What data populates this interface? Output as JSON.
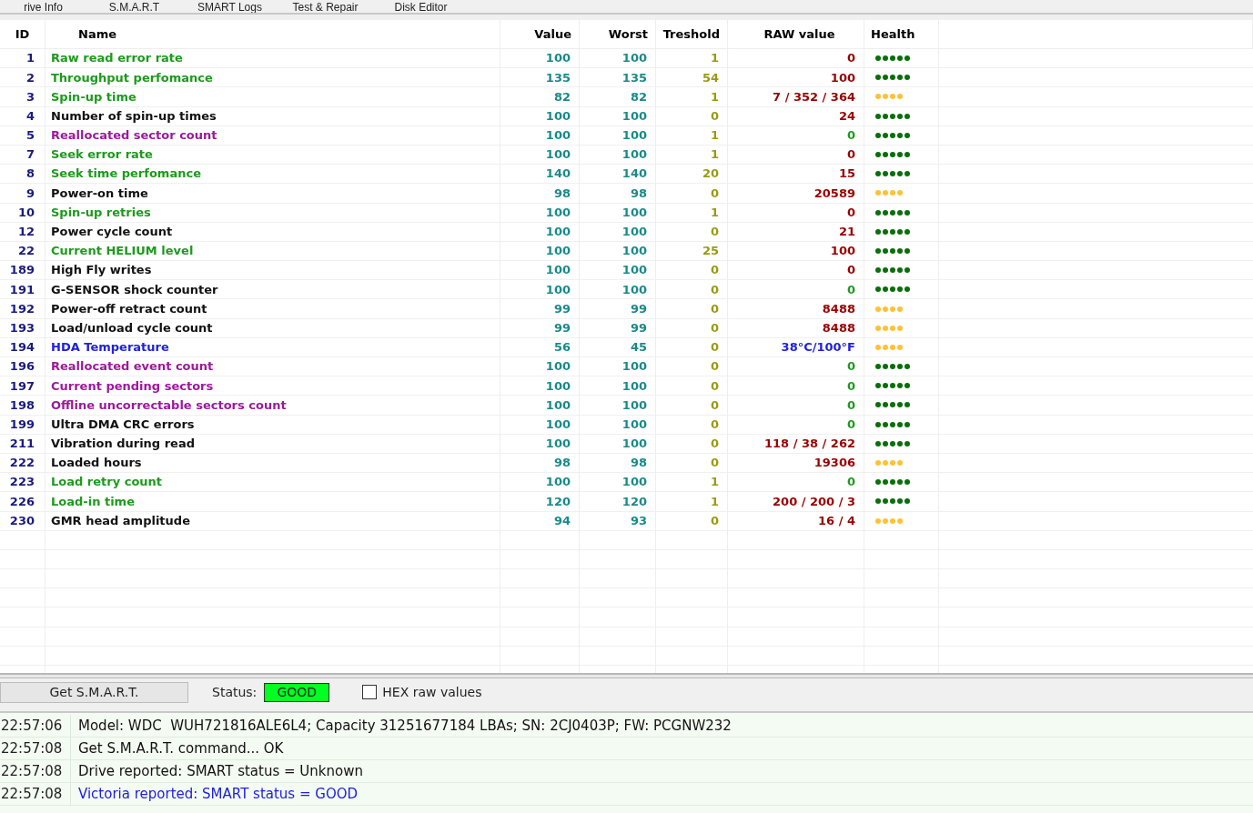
{
  "tabs": [
    {
      "label": "rive Info"
    },
    {
      "label": "S.M.A.R.T"
    },
    {
      "label": "SMART Logs"
    },
    {
      "label": "Test & Repair"
    },
    {
      "label": "Disk Editor"
    }
  ],
  "table": {
    "columns": [
      "ID",
      "Name",
      "Value",
      "Worst",
      "Treshold",
      "RAW value",
      "Health"
    ],
    "rows": [
      {
        "id": "1",
        "name": "Raw read error rate",
        "color": "#1e9a1e",
        "value": "100",
        "worst": "100",
        "threshold": "1",
        "raw": {
          "text": "0",
          "color": "#990000"
        },
        "stars": 5
      },
      {
        "id": "2",
        "name": "Throughput perfomance",
        "color": "#1e9a1e",
        "value": "135",
        "worst": "135",
        "threshold": "54",
        "raw": {
          "text": "100",
          "color": "#990000"
        },
        "stars": 5
      },
      {
        "id": "3",
        "name": "Spin-up time",
        "color": "#1e9a1e",
        "value": "82",
        "worst": "82",
        "threshold": "1",
        "raw": {
          "text": "7 / 352 / 364",
          "color": "#990000"
        },
        "stars": 4
      },
      {
        "id": "4",
        "name": "Number of spin-up times",
        "color": "#111111",
        "value": "100",
        "worst": "100",
        "threshold": "0",
        "raw": {
          "text": "24",
          "color": "#990000"
        },
        "stars": 5
      },
      {
        "id": "5",
        "name": "Reallocated sector count",
        "color": "#9b1a9b",
        "value": "100",
        "worst": "100",
        "threshold": "1",
        "raw": {
          "text": "0",
          "color": "#1e9a1e"
        },
        "stars": 5
      },
      {
        "id": "7",
        "name": "Seek error rate",
        "color": "#1e9a1e",
        "value": "100",
        "worst": "100",
        "threshold": "1",
        "raw": {
          "text": "0",
          "color": "#990000"
        },
        "stars": 5
      },
      {
        "id": "8",
        "name": "Seek time perfomance",
        "color": "#1e9a1e",
        "value": "140",
        "worst": "140",
        "threshold": "20",
        "raw": {
          "text": "15",
          "color": "#990000"
        },
        "stars": 5
      },
      {
        "id": "9",
        "name": "Power-on time",
        "color": "#111111",
        "value": "98",
        "worst": "98",
        "threshold": "0",
        "raw": {
          "text": "20589",
          "color": "#990000"
        },
        "stars": 4
      },
      {
        "id": "10",
        "name": "Spin-up retries",
        "color": "#1e9a1e",
        "value": "100",
        "worst": "100",
        "threshold": "1",
        "raw": {
          "text": "0",
          "color": "#990000"
        },
        "stars": 5
      },
      {
        "id": "12",
        "name": "Power cycle count",
        "color": "#111111",
        "value": "100",
        "worst": "100",
        "threshold": "0",
        "raw": {
          "text": "21",
          "color": "#990000"
        },
        "stars": 5
      },
      {
        "id": "22",
        "name": "Current HELIUM level",
        "color": "#1e9a1e",
        "value": "100",
        "worst": "100",
        "threshold": "25",
        "raw": {
          "text": "100",
          "color": "#990000"
        },
        "stars": 5
      },
      {
        "id": "189",
        "name": "High Fly writes",
        "color": "#111111",
        "value": "100",
        "worst": "100",
        "threshold": "0",
        "raw": {
          "text": "0",
          "color": "#990000"
        },
        "stars": 5
      },
      {
        "id": "191",
        "name": "G-SENSOR shock counter",
        "color": "#111111",
        "value": "100",
        "worst": "100",
        "threshold": "0",
        "raw": {
          "text": "0",
          "color": "#1e9a1e"
        },
        "stars": 5
      },
      {
        "id": "192",
        "name": "Power-off retract count",
        "color": "#111111",
        "value": "99",
        "worst": "99",
        "threshold": "0",
        "raw": {
          "text": "8488",
          "color": "#990000"
        },
        "stars": 4
      },
      {
        "id": "193",
        "name": "Load/unload cycle count",
        "color": "#111111",
        "value": "99",
        "worst": "99",
        "threshold": "0",
        "raw": {
          "text": "8488",
          "color": "#990000"
        },
        "stars": 4
      },
      {
        "id": "194",
        "name": "HDA Temperature",
        "color": "#2020e0",
        "value": "56",
        "worst": "45",
        "threshold": "0",
        "raw": {
          "text": "38°C/100°F",
          "color": "#2020e0"
        },
        "stars": 4
      },
      {
        "id": "196",
        "name": "Reallocated event count",
        "color": "#9b1a9b",
        "value": "100",
        "worst": "100",
        "threshold": "0",
        "raw": {
          "text": "0",
          "color": "#1e9a1e"
        },
        "stars": 5
      },
      {
        "id": "197",
        "name": "Current pending sectors",
        "color": "#9b1a9b",
        "value": "100",
        "worst": "100",
        "threshold": "0",
        "raw": {
          "text": "0",
          "color": "#1e9a1e"
        },
        "stars": 5
      },
      {
        "id": "198",
        "name": "Offline uncorrectable sectors count",
        "color": "#9b1a9b",
        "value": "100",
        "worst": "100",
        "threshold": "0",
        "raw": {
          "text": "0",
          "color": "#1e9a1e"
        },
        "stars": 5
      },
      {
        "id": "199",
        "name": "Ultra DMA CRC errors",
        "color": "#111111",
        "value": "100",
        "worst": "100",
        "threshold": "0",
        "raw": {
          "text": "0",
          "color": "#1e9a1e"
        },
        "stars": 5
      },
      {
        "id": "211",
        "name": "Vibration during read",
        "color": "#111111",
        "value": "100",
        "worst": "100",
        "threshold": "0",
        "raw": {
          "text": "118 / 38 / 262",
          "color": "#990000"
        },
        "stars": 5
      },
      {
        "id": "222",
        "name": "Loaded hours",
        "color": "#111111",
        "value": "98",
        "worst": "98",
        "threshold": "0",
        "raw": {
          "text": "19306",
          "color": "#990000"
        },
        "stars": 4
      },
      {
        "id": "223",
        "name": "Load retry count",
        "color": "#1e9a1e",
        "value": "100",
        "worst": "100",
        "threshold": "1",
        "raw": {
          "text": "0",
          "color": "#1e9a1e"
        },
        "stars": 5
      },
      {
        "id": "226",
        "name": "Load-in time",
        "color": "#1e9a1e",
        "value": "120",
        "worst": "120",
        "threshold": "1",
        "raw": {
          "text": "200 / 200 / 3",
          "color": "#990000"
        },
        "stars": 5
      },
      {
        "id": "230",
        "name": "GMR head amplitude",
        "color": "#111111",
        "value": "94",
        "worst": "93",
        "threshold": "0",
        "raw": {
          "text": "16 / 4",
          "color": "#990000"
        },
        "stars": 4
      }
    ]
  },
  "controls": {
    "button": "Get S.M.A.R.T.",
    "status_label": "Status:",
    "status": "GOOD",
    "hex": {
      "label": "HEX raw values",
      "checked": false
    }
  },
  "log": [
    {
      "time": "22:57:06",
      "message": "Model: WDC  WUH721816ALE6L4; Capacity 31251677184 LBAs; SN: 2CJ0403P; FW: PCGNW232",
      "color": "#111111"
    },
    {
      "time": "22:57:08",
      "message": "Get S.M.A.R.T. command... OK",
      "color": "#111111"
    },
    {
      "time": "22:57:08",
      "message": "Drive reported: SMART status = Unknown",
      "color": "#111111"
    },
    {
      "time": "22:57:08",
      "message": "Victoria reported: SMART status = GOOD",
      "color": "#2020e0"
    }
  ]
}
